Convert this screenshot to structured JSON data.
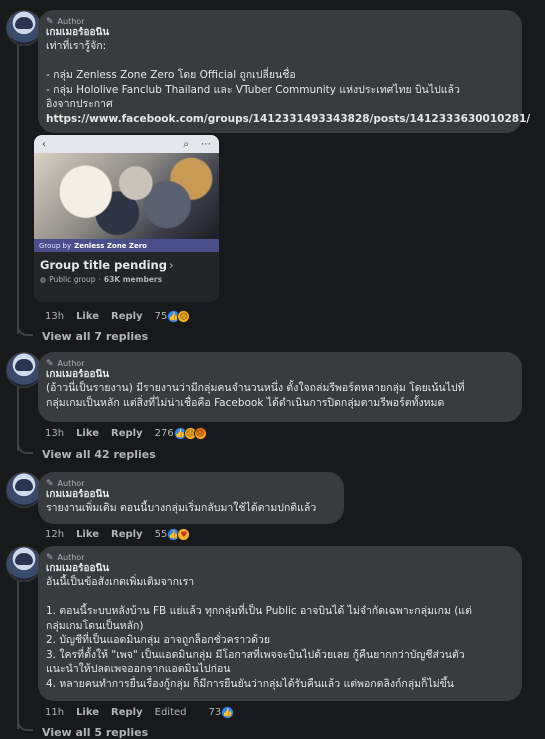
{
  "comments": [
    {
      "badge": "Author",
      "author": "เกมเมอร์ออนิน",
      "text": "เท่าที่เรารู้จัก:\n\n- กลุ่ม Zenless Zone Zero โดย Official ถูกเปลี่ยนชื่อ\n- กลุ่ม Hololive Fanclub Thailand และ VTuber Community แห่งประเทศไทย บินไปแล้ว\nอิงจากประกาศ",
      "link": "https://www.facebook.com/groups/1412331493343828/posts/1412333630010281/",
      "card": {
        "group_strip_prefix": "Group by",
        "group_strip_name": "Zenless Zone Zero",
        "title": "Group title pending",
        "meta_type": "Public group",
        "meta_members": "63K members"
      },
      "time": "13h",
      "like": "Like",
      "reply": "Reply",
      "reactions_count": "75",
      "view_replies": "View all 7 replies"
    },
    {
      "badge": "Author",
      "author": "เกมเมอร์ออนิน",
      "text": "(อ้าวนี่เป็นรายงาน) มีรายงานว่ามีกลุ่มคนจำนวนหนึ่ง ตั้งใจถล่มรีพอร์ตหลายกลุ่ม โดยเน้นไปที่\nกลุ่มเกมเป็นหลัก แต่สิ่งที่ไม่น่าเชื่อคือ Facebook ได้ดำเนินการปิดกลุ่มตามรีพอร์ตทั้งหมด",
      "time": "13h",
      "like": "Like",
      "reply": "Reply",
      "reactions_count": "276",
      "view_replies": "View all 42 replies"
    },
    {
      "badge": "Author",
      "author": "เกมเมอร์ออนิน",
      "text": "รายงานเพิ่มเติม ตอนนี้บางกลุ่มเริ่มกลับมาใช้ได้ตามปกติแล้ว",
      "time": "12h",
      "like": "Like",
      "reply": "Reply",
      "reactions_count": "55"
    },
    {
      "badge": "Author",
      "author": "เกมเมอร์ออนิน",
      "text": "อันนี้เป็นข้อสังเกตเพิ่มเติมจากเรา\n\n1. ตอนนี้ระบบหลังบ้าน FB แย่แล้ว ทุกกลุ่มที่เป็น Public อาจบินได้ ไม่จำกัดเฉพาะกลุ่มเกม (แต่\nกลุ่มเกมโดนเป็นหลัก)\n2. บัญชีที่เป็นแอดมินกลุ่ม อาจถูกล็อกชั่วคราวด้วย\n3. ใครที่ตั้งให้ \"เพจ\" เป็นแอดมินกลุ่ม มีโอกาสที่เพจจะบินไปด้วยเลย กู้คืนยากกว่าบัญชีส่วนตัว\nแนะนำให้ปลดเพจออกจากแอดมินไปก่อน\n4. หลายคนทำการยื่นเรื่องกู้กลุ่ม ก็มีการยืนยันว่ากลุ่มได้รับคืนแล้ว แต่พอกดลิงก์กลุ่มก็ไม่ขึ้น",
      "time": "11h",
      "like": "Like",
      "reply": "Reply",
      "edited": "Edited",
      "reactions_count": "73",
      "view_replies": "View all 5 replies"
    }
  ],
  "colors": {
    "background": "#18191a",
    "bubble": "#3a3b3c",
    "like_blue": "#2e89ff"
  },
  "icons": [
    "pen-icon",
    "back-arrow-icon",
    "search-icon",
    "more-icon",
    "globe-icon",
    "like-reaction-icon",
    "sad-reaction-icon",
    "angry-reaction-icon",
    "care-reaction-icon"
  ]
}
